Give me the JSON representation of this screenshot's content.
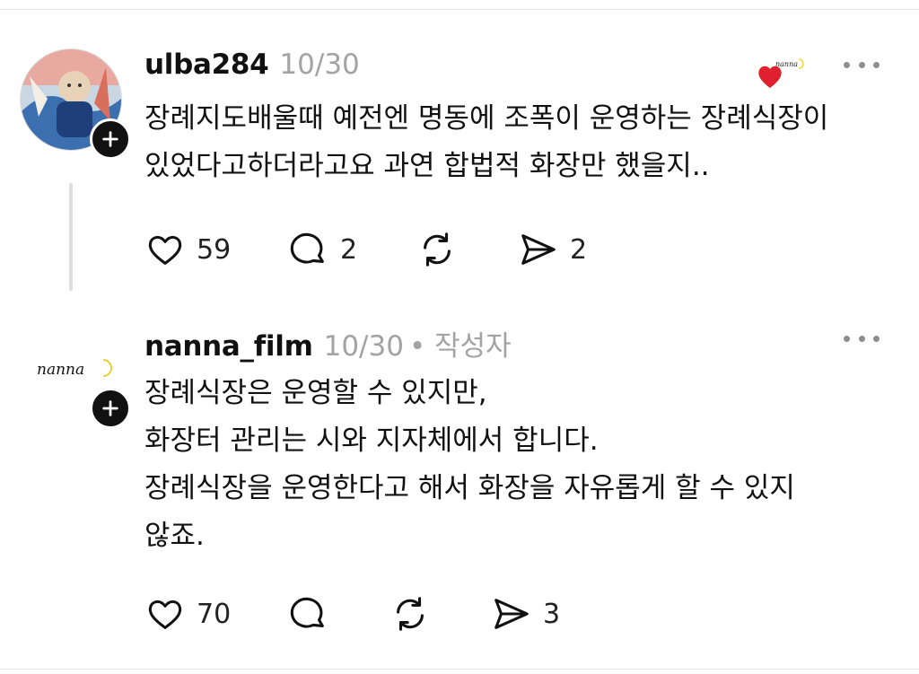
{
  "comments": [
    {
      "username": "ulba284",
      "date": "10/30",
      "lines": [
        "장례지도배울때 예전엔 명동에 조폭이 운영하는 장례식장이",
        "있었다고하더라고요 과연 합법적 화장만 했을지.."
      ],
      "likes": "59",
      "replies": "2",
      "shares": "2",
      "liked_by_author": true,
      "colors": {
        "heart": "#e0202e"
      }
    },
    {
      "username": "nanna_film",
      "date": "10/30",
      "author_tag": "• 작성자",
      "logo_text": "nanna",
      "lines": [
        "장례식장은 운영할 수 있지만,",
        "화장터 관리는 시와 지자체에서 합니다.",
        "장례식장을 운영한다고 해서 화장을 자유롭게 할 수 있지",
        "않죠."
      ],
      "likes": "70",
      "replies": "",
      "shares": "3"
    }
  ]
}
